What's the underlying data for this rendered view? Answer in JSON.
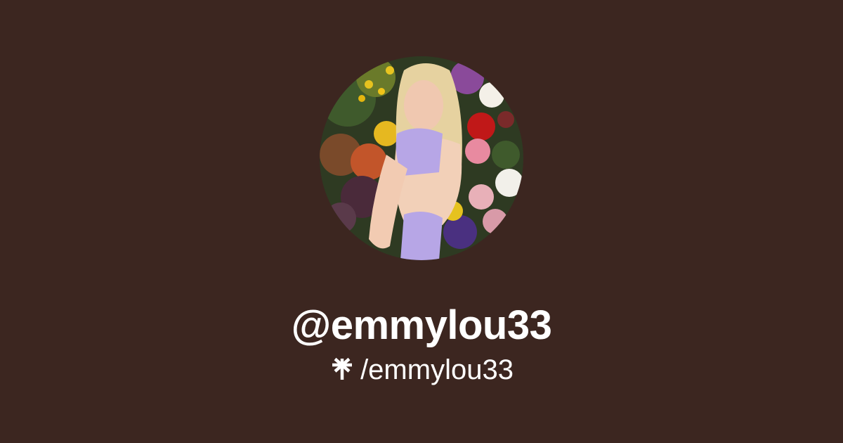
{
  "profile": {
    "handle": "@emmylou33",
    "url_path": "/emmylou33",
    "avatar_icon": "profile-photo",
    "logo_icon": "linktree-asterisk-icon"
  },
  "colors": {
    "background": "#3c2620",
    "text": "#ffffff"
  }
}
